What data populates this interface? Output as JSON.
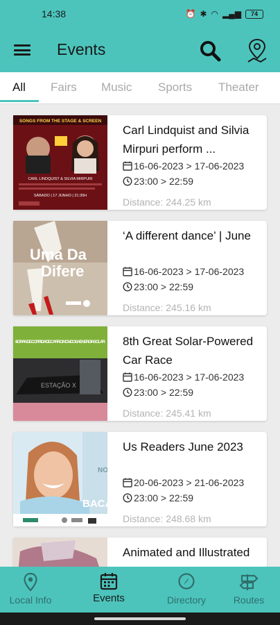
{
  "status": {
    "time": "14:38",
    "battery": "74"
  },
  "header": {
    "title": "Events"
  },
  "tabs": [
    {
      "label": "All",
      "active": true
    },
    {
      "label": "Fairs"
    },
    {
      "label": "Music"
    },
    {
      "label": "Sports"
    },
    {
      "label": "Theater"
    }
  ],
  "events": [
    {
      "title": "Carl Lindquist and Silvia Mirpuri perform ...",
      "dates": "16-06-2023 > 17-06-2023",
      "time": "23:00 > 22:59",
      "distance": "Distance: 244.25 km",
      "thumb": {
        "headline": "SONGS FROM THE STAGE & SCREEN",
        "names": "CARL LINDQUIST & SILVIA MIRPURI",
        "day": "SÁBADO | 17 JUNHO | 21:30H"
      }
    },
    {
      "title": "‘A different dance’ | June",
      "dates": "16-06-2023 > 17-06-2023",
      "time": "23:00 > 22:59",
      "distance": "Distance: 245.16 km",
      "thumb": {
        "line1": "Uma Da",
        "line2": "Difere"
      }
    },
    {
      "title": "8th Great Solar-Powered Car Race",
      "dates": "16-06-2023 > 17-06-2023",
      "time": "23:00 > 22:59",
      "distance": "Distance: 245.41 km",
      "thumb": {
        "banner": "8 GRANDE CORRIDA DE CARRO MOVIDOS A ENERGIA SOLAR",
        "car": "ESTAÇÃO X"
      }
    },
    {
      "title": "Us Readers June 2023",
      "dates": "20-06-2023 > 21-06-2023",
      "time": "23:00 > 22:59",
      "distance": "Distance: 248.68 km",
      "thumb": {
        "text": "BACA",
        "side": "NO"
      }
    },
    {
      "title": "Animated and Illustrated Books",
      "dates": "",
      "time": "",
      "distance": ""
    }
  ],
  "bottom_nav": [
    {
      "label": "Local Info",
      "icon": "location-pin-icon"
    },
    {
      "label": "Events",
      "icon": "calendar-icon",
      "active": true
    },
    {
      "label": "Directory",
      "icon": "compass-icon"
    },
    {
      "label": "Routes",
      "icon": "signpost-icon"
    }
  ],
  "colors": {
    "primary": "#4cc4bc",
    "distance": "#b3b3b3",
    "tab_inactive": "#a9a9a9"
  }
}
